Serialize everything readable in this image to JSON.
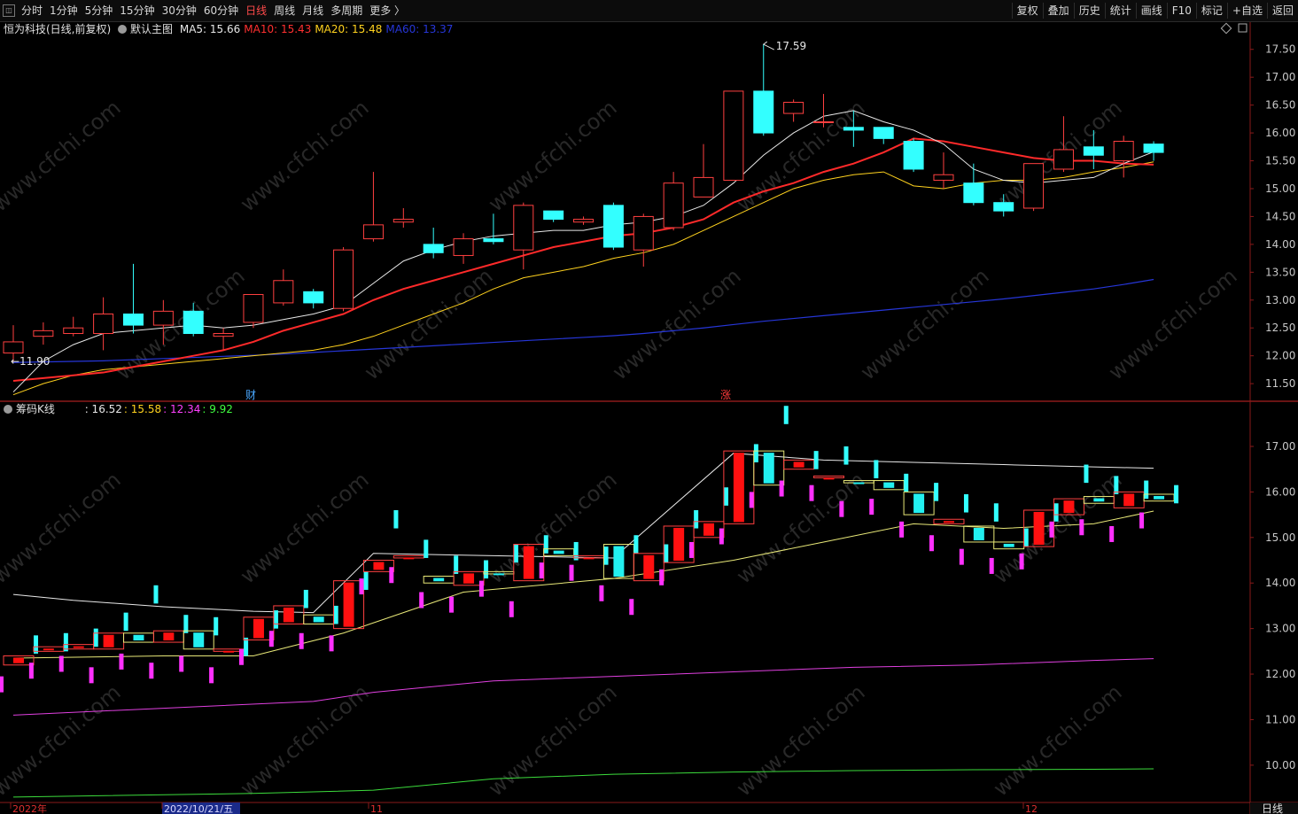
{
  "toolbar": {
    "periods": [
      {
        "label": "分时",
        "active": false
      },
      {
        "label": "1分钟",
        "active": false
      },
      {
        "label": "5分钟",
        "active": false
      },
      {
        "label": "15分钟",
        "active": false
      },
      {
        "label": "30分钟",
        "active": false
      },
      {
        "label": "60分钟",
        "active": false
      },
      {
        "label": "日线",
        "active": true
      },
      {
        "label": "周线",
        "active": false
      },
      {
        "label": "月线",
        "active": false
      },
      {
        "label": "多周期",
        "active": false
      },
      {
        "label": "更多 〉",
        "active": false
      }
    ],
    "actions": [
      "复权",
      "叠加",
      "历史",
      "统计",
      "画线",
      "F10",
      "标记",
      "+自选",
      "返回"
    ]
  },
  "main_pane": {
    "stock_title": "恒为科技(日线,前复权)",
    "indicator_name": "默认主图",
    "ma": [
      {
        "label": "MA5:",
        "value": "15.66",
        "color": "#e8e8e8"
      },
      {
        "label": "MA10:",
        "value": "15.43",
        "color": "#ff3030"
      },
      {
        "label": "MA20:",
        "value": "15.48",
        "color": "#ffd21e"
      },
      {
        "label": "MA60:",
        "value": "13.37",
        "color": "#2636d8"
      }
    ],
    "high_label": "17.59",
    "low_label": "←11.90",
    "markers": [
      {
        "text": "财",
        "color": "#4aa8ff"
      },
      {
        "text": "涨",
        "color": "#ff3a3a"
      }
    ]
  },
  "sub_pane": {
    "indicator_name": "筹码K线",
    "values": [
      {
        "value": ": 16.52",
        "color": "#e8e8e8"
      },
      {
        "value": ": 15.58",
        "color": "#ffd21e"
      },
      {
        "value": ": 12.34",
        "color": "#ff40ff"
      },
      {
        "value": ": 9.92",
        "color": "#40ff40"
      }
    ]
  },
  "bottom_axis": {
    "labels": [
      "2022年",
      "2022/10/21/五",
      "11",
      "12"
    ],
    "period_label": "日线"
  },
  "watermark": "www.cfchi.com",
  "chart_data": {
    "type": "candlestick",
    "main_ylim": [
      11.2,
      17.75
    ],
    "main_yticks": [
      "17.50",
      "17.00",
      "16.50",
      "16.00",
      "15.50",
      "15.00",
      "14.50",
      "14.00",
      "13.50",
      "13.00",
      "12.50",
      "12.00",
      "11.50"
    ],
    "sub_ylim": [
      9.2,
      17.7
    ],
    "sub_yticks": [
      "17.00",
      "16.00",
      "15.00",
      "14.00",
      "13.00",
      "12.00",
      "11.00",
      "10.00"
    ],
    "candles": [
      [
        12.05,
        12.25,
        12.55,
        11.9
      ],
      [
        12.35,
        12.45,
        12.6,
        12.2
      ],
      [
        12.4,
        12.5,
        12.7,
        12.35
      ],
      [
        12.4,
        12.75,
        13.05,
        12.1
      ],
      [
        12.75,
        12.55,
        13.65,
        12.4
      ],
      [
        12.55,
        12.8,
        13.0,
        12.2
      ],
      [
        12.8,
        12.4,
        12.95,
        12.35
      ],
      [
        12.35,
        12.4,
        12.5,
        12.1
      ],
      [
        12.6,
        13.1,
        13.1,
        12.5
      ],
      [
        12.95,
        13.35,
        13.55,
        12.9
      ],
      [
        13.15,
        12.95,
        13.2,
        12.85
      ],
      [
        12.85,
        13.9,
        13.95,
        12.8
      ],
      [
        14.1,
        14.35,
        15.3,
        14.05
      ],
      [
        14.4,
        14.45,
        14.65,
        14.3
      ],
      [
        14.0,
        13.85,
        14.3,
        13.75
      ],
      [
        13.8,
        14.1,
        14.2,
        13.65
      ],
      [
        14.1,
        14.05,
        14.55,
        14.0
      ],
      [
        13.9,
        14.7,
        14.75,
        13.55
      ],
      [
        14.6,
        14.45,
        14.6,
        14.4
      ],
      [
        14.4,
        14.45,
        14.5,
        14.35
      ],
      [
        14.7,
        13.95,
        14.75,
        13.9
      ],
      [
        13.9,
        14.5,
        14.55,
        13.6
      ],
      [
        14.3,
        15.1,
        15.3,
        14.25
      ],
      [
        14.85,
        15.2,
        15.8,
        14.85
      ],
      [
        15.15,
        16.75,
        16.75,
        15.15
      ],
      [
        16.75,
        16.0,
        17.59,
        15.95
      ],
      [
        16.35,
        16.55,
        16.6,
        16.2
      ],
      [
        16.2,
        16.2,
        16.7,
        16.1
      ],
      [
        16.1,
        16.05,
        16.4,
        15.75
      ],
      [
        16.1,
        15.9,
        16.1,
        15.8
      ],
      [
        15.85,
        15.35,
        15.9,
        15.3
      ],
      [
        15.15,
        15.25,
        15.65,
        15.0
      ],
      [
        15.1,
        14.75,
        15.45,
        14.7
      ],
      [
        14.75,
        14.6,
        14.9,
        14.5
      ],
      [
        14.65,
        15.45,
        15.45,
        14.6
      ],
      [
        15.35,
        15.7,
        16.3,
        15.3
      ],
      [
        15.75,
        15.6,
        16.05,
        15.35
      ],
      [
        15.5,
        15.85,
        15.95,
        15.2
      ],
      [
        15.8,
        15.65,
        15.85,
        15.5
      ]
    ],
    "ma5": [
      11.35,
      11.9,
      12.2,
      12.4,
      12.45,
      12.5,
      12.55,
      12.5,
      12.55,
      12.65,
      12.75,
      12.9,
      13.3,
      13.7,
      13.9,
      14.05,
      14.15,
      14.2,
      14.25,
      14.25,
      14.35,
      14.4,
      14.5,
      14.7,
      15.1,
      15.6,
      16.0,
      16.3,
      16.4,
      16.2,
      16.05,
      15.8,
      15.35,
      15.15,
      15.1,
      15.15,
      15.2,
      15.45,
      15.66
    ],
    "ma10": [
      11.55,
      11.6,
      11.65,
      11.7,
      11.8,
      11.9,
      12.0,
      12.1,
      12.25,
      12.45,
      12.6,
      12.75,
      13.0,
      13.2,
      13.35,
      13.5,
      13.65,
      13.8,
      13.95,
      14.05,
      14.15,
      14.2,
      14.3,
      14.45,
      14.75,
      14.95,
      15.1,
      15.3,
      15.45,
      15.65,
      15.9,
      15.85,
      15.75,
      15.65,
      15.55,
      15.5,
      15.5,
      15.45,
      15.43
    ],
    "ma20": [
      11.3,
      11.5,
      11.65,
      11.75,
      11.8,
      11.85,
      11.9,
      11.95,
      12.0,
      12.05,
      12.1,
      12.2,
      12.35,
      12.55,
      12.75,
      12.95,
      13.2,
      13.4,
      13.5,
      13.6,
      13.75,
      13.85,
      14.0,
      14.25,
      14.5,
      14.75,
      15.0,
      15.15,
      15.25,
      15.3,
      15.05,
      15.0,
      15.1,
      15.15,
      15.15,
      15.2,
      15.3,
      15.38,
      15.48
    ],
    "ma60": [
      11.88,
      11.89,
      11.9,
      11.91,
      11.93,
      11.95,
      11.97,
      11.99,
      12.01,
      12.03,
      12.06,
      12.09,
      12.12,
      12.15,
      12.18,
      12.21,
      12.24,
      12.27,
      12.3,
      12.33,
      12.36,
      12.4,
      12.45,
      12.5,
      12.56,
      12.62,
      12.67,
      12.72,
      12.77,
      12.82,
      12.87,
      12.92,
      12.97,
      13.02,
      13.08,
      13.14,
      13.2,
      13.28,
      13.37
    ],
    "sub_lines": {
      "white": [
        [
          0,
          13.75
        ],
        [
          2,
          13.62
        ],
        [
          5,
          13.48
        ],
        [
          8,
          13.38
        ],
        [
          10,
          13.35
        ],
        [
          12,
          14.65
        ],
        [
          16,
          14.6
        ],
        [
          20,
          14.55
        ],
        [
          24,
          16.85
        ],
        [
          27,
          16.7
        ],
        [
          30,
          16.65
        ],
        [
          33,
          16.6
        ],
        [
          36,
          16.55
        ],
        [
          38,
          16.52
        ]
      ],
      "yellow": [
        [
          0,
          12.35
        ],
        [
          5,
          12.4
        ],
        [
          8,
          12.4
        ],
        [
          11,
          12.9
        ],
        [
          15,
          13.8
        ],
        [
          20,
          14.1
        ],
        [
          24,
          14.5
        ],
        [
          27,
          14.9
        ],
        [
          30,
          15.3
        ],
        [
          33,
          15.2
        ],
        [
          36,
          15.3
        ],
        [
          38,
          15.58
        ]
      ],
      "magenta": [
        [
          0,
          11.1
        ],
        [
          5,
          11.25
        ],
        [
          10,
          11.4
        ],
        [
          12,
          11.6
        ],
        [
          16,
          11.85
        ],
        [
          20,
          11.95
        ],
        [
          24,
          12.05
        ],
        [
          28,
          12.15
        ],
        [
          32,
          12.2
        ],
        [
          36,
          12.3
        ],
        [
          38,
          12.34
        ]
      ],
      "green": [
        [
          0,
          9.3
        ],
        [
          8,
          9.38
        ],
        [
          12,
          9.45
        ],
        [
          16,
          9.7
        ],
        [
          20,
          9.8
        ],
        [
          24,
          9.85
        ],
        [
          28,
          9.88
        ],
        [
          32,
          9.9
        ],
        [
          36,
          9.91
        ],
        [
          38,
          9.92
        ]
      ]
    }
  }
}
